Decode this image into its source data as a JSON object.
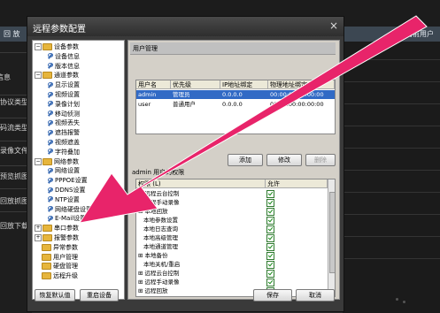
{
  "background": {
    "top_right_text": "当前用户",
    "bar_left_text": "回 放",
    "left_items": [
      "信息",
      "协议类型",
      "码流类型",
      "录像文件",
      "预览抓图",
      "回放抓图",
      "回放下载"
    ]
  },
  "dialog": {
    "title": "远程参数配置",
    "close_glyph": "×",
    "tree": [
      {
        "label": "设备参数",
        "kind": "folder",
        "expanded": true,
        "level": 0
      },
      {
        "label": "设备信息",
        "kind": "leaf",
        "level": 1
      },
      {
        "label": "版本信息",
        "kind": "leaf",
        "level": 1
      },
      {
        "label": "通道参数",
        "kind": "folder",
        "expanded": true,
        "level": 0
      },
      {
        "label": "显示设置",
        "kind": "leaf",
        "level": 1
      },
      {
        "label": "视频设置",
        "kind": "leaf",
        "level": 1
      },
      {
        "label": "录像计划",
        "kind": "leaf",
        "level": 1
      },
      {
        "label": "移动侦测",
        "kind": "leaf",
        "level": 1
      },
      {
        "label": "视频丢失",
        "kind": "leaf",
        "level": 1
      },
      {
        "label": "遮挡报警",
        "kind": "leaf",
        "level": 1
      },
      {
        "label": "视频遮盖",
        "kind": "leaf",
        "level": 1
      },
      {
        "label": "字符叠加",
        "kind": "leaf",
        "level": 1
      },
      {
        "label": "网络参数",
        "kind": "folder",
        "expanded": true,
        "level": 0
      },
      {
        "label": "网络设置",
        "kind": "leaf",
        "level": 1
      },
      {
        "label": "PPPOE设置",
        "kind": "leaf",
        "level": 1
      },
      {
        "label": "DDNS设置",
        "kind": "leaf",
        "level": 1
      },
      {
        "label": "NTP设置",
        "kind": "leaf",
        "level": 1
      },
      {
        "label": "网络硬盘设置",
        "kind": "leaf",
        "level": 1
      },
      {
        "label": "E-Mail设置",
        "kind": "leaf",
        "level": 1
      },
      {
        "label": "串口参数",
        "kind": "folder",
        "expanded": false,
        "level": 0
      },
      {
        "label": "报警参数",
        "kind": "folder",
        "expanded": false,
        "level": 0
      },
      {
        "label": "异常参数",
        "kind": "folder",
        "expanded": null,
        "level": 0
      },
      {
        "label": "用户管理",
        "kind": "folder",
        "expanded": null,
        "level": 0
      },
      {
        "label": "硬盘管理",
        "kind": "folder",
        "expanded": null,
        "level": 0
      },
      {
        "label": "远程升级",
        "kind": "folder",
        "expanded": null,
        "level": 0
      }
    ],
    "panel_title": "用户管理",
    "user_table": {
      "columns": [
        "用户名",
        "优先级",
        "IP地址绑定",
        "物理地址绑定"
      ],
      "rows": [
        [
          "admin",
          "管理员",
          "0.0.0.0",
          "00:00:00:00:00:00"
        ],
        [
          "user",
          "普通用户",
          "0.0.0.0",
          "00:00:00:00:00:00"
        ]
      ],
      "selected_row": 0
    },
    "buttons": {
      "add": "添加",
      "modify": "修改",
      "delete": "删除",
      "restore": "恢复默认值",
      "restart": "重启设备",
      "save": "保存",
      "cancel": "取消"
    },
    "perm_label": "admin 用户的权限",
    "perm_table": {
      "columns": [
        "权限 (L)",
        "允许"
      ],
      "rows": [
        {
          "label": "远程云台控制",
          "prefix": "⊟",
          "indent": 0,
          "checked": true
        },
        {
          "label": "远程手动录像",
          "prefix": "⊟",
          "indent": 0,
          "checked": true
        },
        {
          "label": "本地回放",
          "prefix": "⊟",
          "indent": 0,
          "checked": true
        },
        {
          "label": "本地参数设置",
          "prefix": "",
          "indent": 1,
          "checked": true
        },
        {
          "label": "本地日志查询",
          "prefix": "",
          "indent": 1,
          "checked": true
        },
        {
          "label": "本地高级管理",
          "prefix": "",
          "indent": 1,
          "checked": true
        },
        {
          "label": "本地通道管理",
          "prefix": "",
          "indent": 1,
          "checked": true
        },
        {
          "label": "本地备份",
          "prefix": "⊞",
          "indent": 0,
          "checked": true
        },
        {
          "label": "本地关机/重启",
          "prefix": "",
          "indent": 1,
          "checked": true
        },
        {
          "label": "远程云台控制",
          "prefix": "⊞",
          "indent": 0,
          "checked": true
        },
        {
          "label": "远程手动录像",
          "prefix": "⊞",
          "indent": 0,
          "checked": true
        },
        {
          "label": "远程回放",
          "prefix": "⊞",
          "indent": 0,
          "checked": true
        }
      ]
    }
  },
  "annotation_arrow": {
    "color": "#e8246a"
  }
}
